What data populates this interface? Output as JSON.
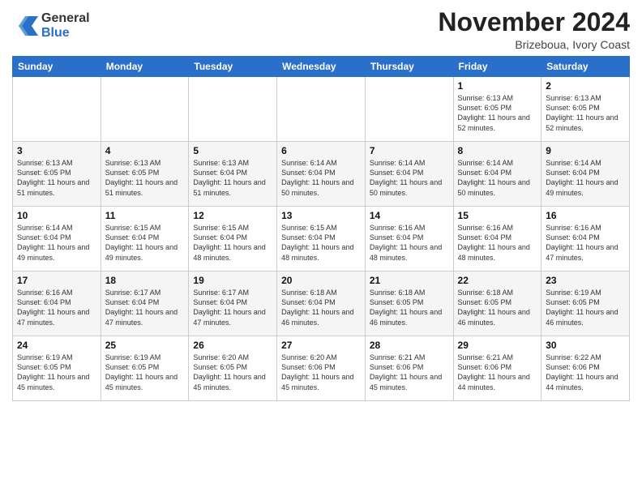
{
  "logo": {
    "general": "General",
    "blue": "Blue"
  },
  "header": {
    "month": "November 2024",
    "location": "Brizeboua, Ivory Coast"
  },
  "weekdays": [
    "Sunday",
    "Monday",
    "Tuesday",
    "Wednesday",
    "Thursday",
    "Friday",
    "Saturday"
  ],
  "weeks": [
    [
      {
        "day": "",
        "info": ""
      },
      {
        "day": "",
        "info": ""
      },
      {
        "day": "",
        "info": ""
      },
      {
        "day": "",
        "info": ""
      },
      {
        "day": "",
        "info": ""
      },
      {
        "day": "1",
        "info": "Sunrise: 6:13 AM\nSunset: 6:05 PM\nDaylight: 11 hours and 52 minutes."
      },
      {
        "day": "2",
        "info": "Sunrise: 6:13 AM\nSunset: 6:05 PM\nDaylight: 11 hours and 52 minutes."
      }
    ],
    [
      {
        "day": "3",
        "info": "Sunrise: 6:13 AM\nSunset: 6:05 PM\nDaylight: 11 hours and 51 minutes."
      },
      {
        "day": "4",
        "info": "Sunrise: 6:13 AM\nSunset: 6:05 PM\nDaylight: 11 hours and 51 minutes."
      },
      {
        "day": "5",
        "info": "Sunrise: 6:13 AM\nSunset: 6:04 PM\nDaylight: 11 hours and 51 minutes."
      },
      {
        "day": "6",
        "info": "Sunrise: 6:14 AM\nSunset: 6:04 PM\nDaylight: 11 hours and 50 minutes."
      },
      {
        "day": "7",
        "info": "Sunrise: 6:14 AM\nSunset: 6:04 PM\nDaylight: 11 hours and 50 minutes."
      },
      {
        "day": "8",
        "info": "Sunrise: 6:14 AM\nSunset: 6:04 PM\nDaylight: 11 hours and 50 minutes."
      },
      {
        "day": "9",
        "info": "Sunrise: 6:14 AM\nSunset: 6:04 PM\nDaylight: 11 hours and 49 minutes."
      }
    ],
    [
      {
        "day": "10",
        "info": "Sunrise: 6:14 AM\nSunset: 6:04 PM\nDaylight: 11 hours and 49 minutes."
      },
      {
        "day": "11",
        "info": "Sunrise: 6:15 AM\nSunset: 6:04 PM\nDaylight: 11 hours and 49 minutes."
      },
      {
        "day": "12",
        "info": "Sunrise: 6:15 AM\nSunset: 6:04 PM\nDaylight: 11 hours and 48 minutes."
      },
      {
        "day": "13",
        "info": "Sunrise: 6:15 AM\nSunset: 6:04 PM\nDaylight: 11 hours and 48 minutes."
      },
      {
        "day": "14",
        "info": "Sunrise: 6:16 AM\nSunset: 6:04 PM\nDaylight: 11 hours and 48 minutes."
      },
      {
        "day": "15",
        "info": "Sunrise: 6:16 AM\nSunset: 6:04 PM\nDaylight: 11 hours and 48 minutes."
      },
      {
        "day": "16",
        "info": "Sunrise: 6:16 AM\nSunset: 6:04 PM\nDaylight: 11 hours and 47 minutes."
      }
    ],
    [
      {
        "day": "17",
        "info": "Sunrise: 6:16 AM\nSunset: 6:04 PM\nDaylight: 11 hours and 47 minutes."
      },
      {
        "day": "18",
        "info": "Sunrise: 6:17 AM\nSunset: 6:04 PM\nDaylight: 11 hours and 47 minutes."
      },
      {
        "day": "19",
        "info": "Sunrise: 6:17 AM\nSunset: 6:04 PM\nDaylight: 11 hours and 47 minutes."
      },
      {
        "day": "20",
        "info": "Sunrise: 6:18 AM\nSunset: 6:04 PM\nDaylight: 11 hours and 46 minutes."
      },
      {
        "day": "21",
        "info": "Sunrise: 6:18 AM\nSunset: 6:05 PM\nDaylight: 11 hours and 46 minutes."
      },
      {
        "day": "22",
        "info": "Sunrise: 6:18 AM\nSunset: 6:05 PM\nDaylight: 11 hours and 46 minutes."
      },
      {
        "day": "23",
        "info": "Sunrise: 6:19 AM\nSunset: 6:05 PM\nDaylight: 11 hours and 46 minutes."
      }
    ],
    [
      {
        "day": "24",
        "info": "Sunrise: 6:19 AM\nSunset: 6:05 PM\nDaylight: 11 hours and 45 minutes."
      },
      {
        "day": "25",
        "info": "Sunrise: 6:19 AM\nSunset: 6:05 PM\nDaylight: 11 hours and 45 minutes."
      },
      {
        "day": "26",
        "info": "Sunrise: 6:20 AM\nSunset: 6:05 PM\nDaylight: 11 hours and 45 minutes."
      },
      {
        "day": "27",
        "info": "Sunrise: 6:20 AM\nSunset: 6:06 PM\nDaylight: 11 hours and 45 minutes."
      },
      {
        "day": "28",
        "info": "Sunrise: 6:21 AM\nSunset: 6:06 PM\nDaylight: 11 hours and 45 minutes."
      },
      {
        "day": "29",
        "info": "Sunrise: 6:21 AM\nSunset: 6:06 PM\nDaylight: 11 hours and 44 minutes."
      },
      {
        "day": "30",
        "info": "Sunrise: 6:22 AM\nSunset: 6:06 PM\nDaylight: 11 hours and 44 minutes."
      }
    ]
  ]
}
